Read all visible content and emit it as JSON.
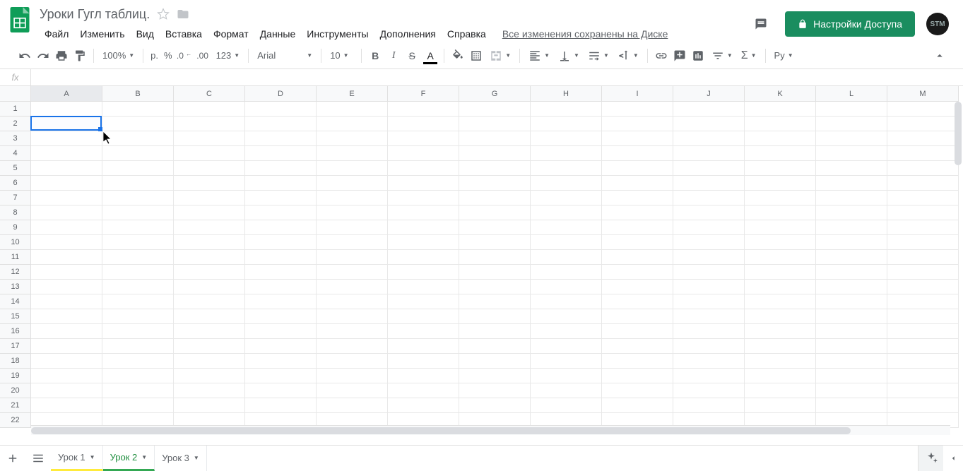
{
  "doc": {
    "title": "Уроки Гугл таблиц."
  },
  "menubar": [
    "Файл",
    "Изменить",
    "Вид",
    "Вставка",
    "Формат",
    "Данные",
    "Инструменты",
    "Дополнения",
    "Справка"
  ],
  "save_status": "Все изменения сохранены на Диске",
  "share_label": "Настройки Доступа",
  "avatar_text": "STM",
  "toolbar": {
    "zoom": "100%",
    "currency": "р.",
    "percent": "%",
    "dec_less": ".0",
    "dec_more": ".00",
    "more_fmt": "123",
    "font": "Arial",
    "size": "10",
    "input_lang": "Ру"
  },
  "fx": {
    "label": "fx",
    "value": ""
  },
  "columns": [
    "A",
    "B",
    "C",
    "D",
    "E",
    "F",
    "G",
    "H",
    "I",
    "J",
    "K",
    "L",
    "M"
  ],
  "rows": [
    "1",
    "2",
    "3",
    "4",
    "5",
    "6",
    "7",
    "8",
    "9",
    "10",
    "11",
    "12",
    "13",
    "14",
    "15",
    "16",
    "17",
    "18",
    "19",
    "20",
    "21",
    "22"
  ],
  "selected": {
    "col": 0,
    "row": 1
  },
  "sheets": [
    {
      "name": "Урок 1",
      "cls": "tab1"
    },
    {
      "name": "Урок 2",
      "cls": "tab2"
    },
    {
      "name": "Урок 3",
      "cls": "tab3"
    }
  ]
}
